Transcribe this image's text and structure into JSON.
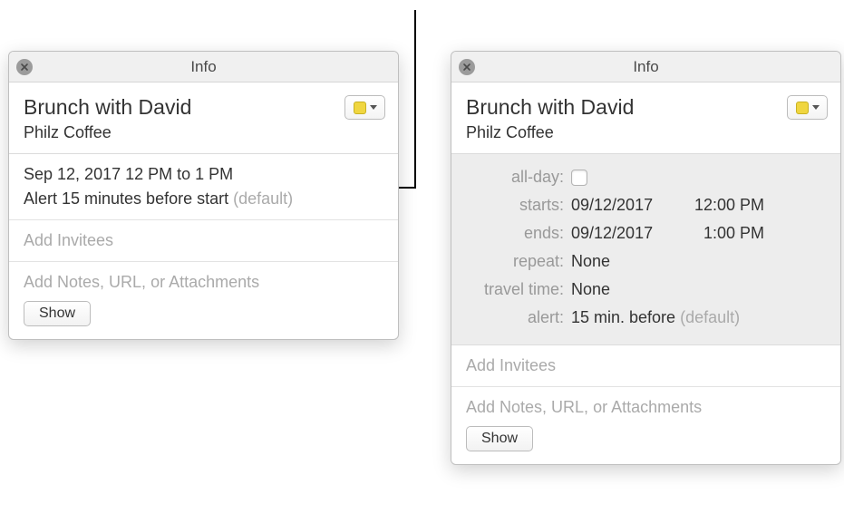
{
  "left": {
    "title": "Info",
    "event_title": "Brunch with David",
    "event_location": "Philz Coffee",
    "summary_time": "Sep 12, 2017  12 PM to 1 PM",
    "summary_alert_prefix": "Alert 15 minutes before start ",
    "summary_alert_suffix": "(default)",
    "invitees_placeholder": "Add Invitees",
    "notes_placeholder": "Add Notes, URL, or Attachments",
    "show_label": "Show"
  },
  "right": {
    "title": "Info",
    "event_title": "Brunch with David",
    "event_location": "Philz Coffee",
    "labels": {
      "allday": "all-day:",
      "starts": "starts:",
      "ends": "ends:",
      "repeat": "repeat:",
      "travel": "travel time:",
      "alert": "alert:"
    },
    "starts_date": "09/12/2017",
    "starts_time": "12:00 PM",
    "ends_date": "09/12/2017",
    "ends_time": "1:00 PM",
    "repeat_value": "None",
    "travel_value": "None",
    "alert_value": "15 min. before ",
    "alert_suffix": "(default)",
    "invitees_placeholder": "Add Invitees",
    "notes_placeholder": "Add Notes, URL, or Attachments",
    "show_label": "Show"
  },
  "colors": {
    "swatch": "#f0d640"
  }
}
